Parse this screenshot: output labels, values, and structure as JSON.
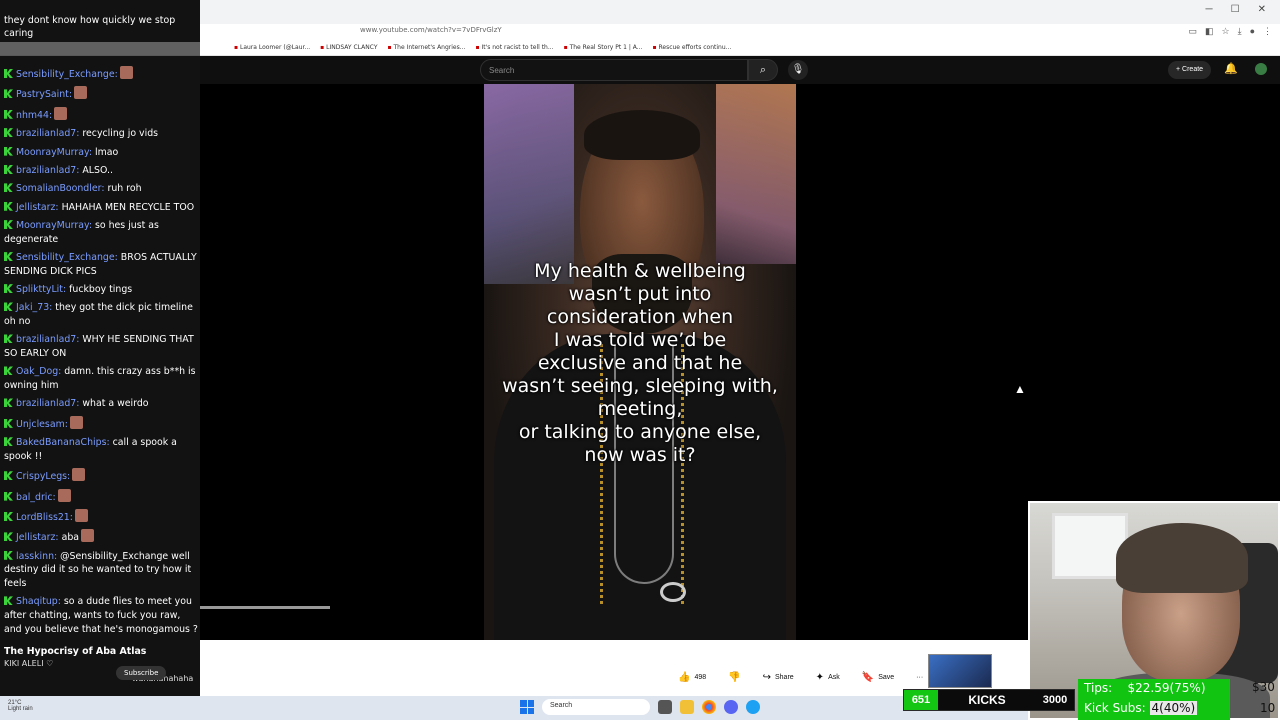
{
  "browser": {
    "url": "www.youtube.com/watch?v=7vDFrvGlzY",
    "bookmarks": [
      "Laura Loomer (@Laur...",
      "LINDSAY CLANCY",
      "The Internet's Angries...",
      "It's not racist to tell th...",
      "The Real Story Pt 1 | A...",
      "Rescue efforts continu..."
    ]
  },
  "youtube": {
    "search_placeholder": "Search",
    "create_label": "Create",
    "video_caption": "My health & wellbeing\nwasn’t put into\nconsideration when\nI was told we’d be\nexclusive and that he\nwasn’t seeing, sleeping with,\nmeeting,\nor talking to anyone else,\nnow was it?",
    "actions": {
      "likes": "498",
      "share": "Share",
      "ask": "Ask",
      "save": "Save",
      "more": "···"
    }
  },
  "chat": {
    "top_message": "they dont know how quickly we stop caring",
    "messages": [
      {
        "user": "Sensibility_Exchange:",
        "text": "",
        "emote": true
      },
      {
        "user": "PastrySaint:",
        "text": "",
        "emote": true
      },
      {
        "user": "nhm44:",
        "text": "",
        "emote": true
      },
      {
        "user": "brazilianlad7:",
        "text": "recycling jo vids",
        "emote": false
      },
      {
        "user": "MoonrayMurray:",
        "text": "lmao",
        "emote": false
      },
      {
        "user": "brazilianlad7:",
        "text": "ALSO..",
        "emote": false
      },
      {
        "user": "SomalianBoondler:",
        "text": "ruh roh",
        "emote": false
      },
      {
        "user": "Jellistarz:",
        "text": "HAHAHA MEN RECYCLE TOO",
        "emote": false
      },
      {
        "user": "MoonrayMurray:",
        "text": "so hes just as degenerate",
        "emote": false
      },
      {
        "user": "Sensibility_Exchange:",
        "text": "BROS ACTUALLY SENDING DICK PICS",
        "emote": false
      },
      {
        "user": "SplikttyLit:",
        "text": "fuckboy tings",
        "emote": false
      },
      {
        "user": "Jaki_73:",
        "text": "they got the dick pic timeline oh no",
        "emote": false
      },
      {
        "user": "brazilianlad7:",
        "text": "WHY HE SENDING THAT SO EARLY ON",
        "emote": false
      },
      {
        "user": "Oak_Dog:",
        "text": "damn. this crazy ass b**h is owning him",
        "emote": false
      },
      {
        "user": "brazilianlad7:",
        "text": "what a weirdo",
        "emote": false
      },
      {
        "user": "Unjclesam:",
        "text": "",
        "emote": true
      },
      {
        "user": "BakedBananaChips:",
        "text": "call a spook a spook !!",
        "emote": false
      },
      {
        "user": "CrispyLegs:",
        "text": "",
        "emote": true
      },
      {
        "user": "bal_dric:",
        "text": "",
        "emote": true
      },
      {
        "user": "LordBliss21:",
        "text": "",
        "emote": true
      },
      {
        "user": "Jellistarz:",
        "text": "aba",
        "emote": true
      },
      {
        "user": "lasskinn:",
        "text": "@Sensibility_Exchange well destiny did it so he wanted to try how it feels",
        "emote": false
      },
      {
        "user": "Shaqitup:",
        "text": "so a dude flies to meet you after chatting, wants to fuck you raw, and you believe that he's monogamous ?",
        "emote": false
      }
    ],
    "video_title": "The Hypocrisy of Aba Atlas",
    "channel_name": "KIKI ALELI ♡",
    "subscribe_label": "Subscribe",
    "last_message": "wahahahahaha"
  },
  "taskbar": {
    "weather": "21°C",
    "weather_sub": "Light rain",
    "search_label": "Search"
  },
  "overlay": {
    "kicks_count": "651",
    "kicks_label": "KICKS",
    "kicks_goal": "3000",
    "tips_label": "Tips:",
    "tips_value": "$22.59(75%)",
    "tips_goal": "$30",
    "subs_label": "Kick Subs:",
    "subs_value": "4(40%)",
    "subs_goal": "10"
  }
}
